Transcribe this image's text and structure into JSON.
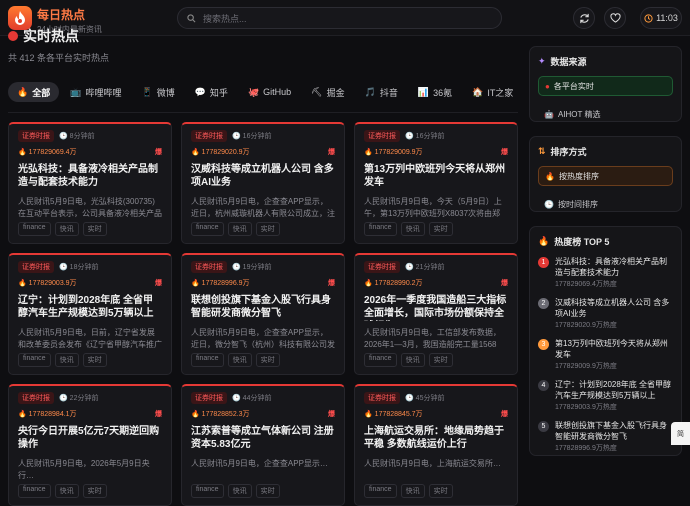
{
  "header": {
    "app_title": "每日热点",
    "app_subtitle": "24小时内最新资讯",
    "search_placeholder": "搜索热点...",
    "clock": "11:03"
  },
  "main": {
    "heading": "实时热点",
    "subtitle": "共 412 条各平台实时热点",
    "tabs": [
      {
        "icon": "🔥",
        "label": "全部",
        "active": true
      },
      {
        "icon": "📺",
        "label": "哔哩哔哩"
      },
      {
        "icon": "📱",
        "label": "微博"
      },
      {
        "icon": "💬",
        "label": "知乎"
      },
      {
        "icon": "🐙",
        "label": "GitHub"
      },
      {
        "icon": "⛏",
        "label": "掘金"
      },
      {
        "icon": "🎵",
        "label": "抖音"
      },
      {
        "icon": "📊",
        "label": "36氪"
      },
      {
        "icon": "🏠",
        "label": "IT之家"
      }
    ],
    "cards": [
      {
        "badge": "证券时报",
        "time": "8分钟前",
        "hot": "177829069.4万",
        "hot_tag": "爆",
        "title": "光弘科技：具备液冷相关产品制造与配套技术能力",
        "desc": "人民财讯5月9日电，光弘科技(300735)在互动平台表示，公司具备液冷相关产品成…",
        "tags": [
          "finance",
          "快讯",
          "实时"
        ]
      },
      {
        "badge": "证券时报",
        "time": "16分钟前",
        "hot": "177829020.9万",
        "hot_tag": "爆",
        "title": "汉威科技等成立机器人公司 含多项AI业务",
        "desc": "人民财讯5月9日电，企查查APP显示，近日，杭州威璇机器人有限公司成立，注册…",
        "tags": [
          "finance",
          "快讯",
          "实时"
        ]
      },
      {
        "badge": "证券时报",
        "time": "16分钟前",
        "hot": "177829009.9万",
        "hot_tag": "爆",
        "title": "第13万列中欧班列今天将从郑州发车",
        "desc": "人民财讯5月9日电，今天（5月9日）上午，第13万列中欧班列X8037次将由郑州…",
        "tags": [
          "finance",
          "快讯",
          "实时"
        ]
      },
      {
        "badge": "证券时报",
        "time": "18分钟前",
        "hot": "177829003.9万",
        "hot_tag": "爆",
        "title": "辽宁：计划到2028年底 全省甲醇汽车生产规模达到5万辆以上",
        "desc": "人民财讯5月9日电，日前，辽宁省发展和改革委员会发布《辽宁省甲醇汽车推广应…",
        "tags": [
          "finance",
          "快讯",
          "实时"
        ]
      },
      {
        "badge": "证券时报",
        "time": "19分钟前",
        "hot": "177828996.9万",
        "hot_tag": "爆",
        "title": "联想创投旗下基金入股飞行具身智能研发商微分智飞",
        "desc": "人民财讯5月9日电，企查查APP显示，近日，微分智飞（杭州）科技有限公司发生…",
        "tags": [
          "finance",
          "快讯",
          "实时"
        ]
      },
      {
        "badge": "证券时报",
        "time": "21分钟前",
        "hot": "177828990.2万",
        "hot_tag": "爆",
        "title": "2026年一季度我国造船三大指标全面增长，国际市场份额保持全球领先",
        "desc": "人民财讯5月9日电，工信部发布数据，2026年1—3月，我国造船完工量1568万…",
        "tags": [
          "finance",
          "快讯",
          "实时"
        ]
      },
      {
        "badge": "证券时报",
        "time": "22分钟前",
        "hot": "177828984.1万",
        "hot_tag": "爆",
        "title": "央行今日开展5亿元7天期逆回购操作",
        "desc": "人民财讯5月9日电，2026年5月9日央行…",
        "tags": [
          "finance",
          "快讯",
          "实时"
        ]
      },
      {
        "badge": "证券时报",
        "time": "44分钟前",
        "hot": "177828852.3万",
        "hot_tag": "爆",
        "title": "江苏索普等成立气体新公司 注册资本5.83亿元",
        "desc": "人民财讯5月9日电，企查查APP显示…",
        "tags": [
          "finance",
          "快讯",
          "实时"
        ]
      },
      {
        "badge": "证券时报",
        "time": "45分钟前",
        "hot": "177828845.7万",
        "hot_tag": "爆",
        "title": "上海航运交易所：地缘局势趋于平稳 多数航线运价上行",
        "desc": "人民财讯5月9日电，上海航运交易所…",
        "tags": [
          "finance",
          "快讯",
          "实时"
        ]
      }
    ]
  },
  "right": {
    "source": {
      "title": "数据来源",
      "options": [
        "各平台实时",
        "AIHOT 精选"
      ]
    },
    "sort": {
      "title": "排序方式",
      "options": [
        "按热度排序",
        "按时间排序"
      ]
    },
    "top": {
      "title": "热度榜 TOP 5",
      "items": [
        {
          "rank": "1",
          "title": "光弘科技：具备液冷相关产品制造与配套技术能力",
          "heat": "177829069.4万热度"
        },
        {
          "rank": "2",
          "title": "汉威科技等成立机器人公司 含多项AI业务",
          "heat": "177829020.9万热度"
        },
        {
          "rank": "3",
          "title": "第13万列中欧班列今天将从郑州发车",
          "heat": "177829009.9万热度"
        },
        {
          "rank": "4",
          "title": "辽宁：计划到2028年底 全省甲醇汽车生产规模达到5万辆以上",
          "heat": "177829003.9万热度"
        },
        {
          "rank": "5",
          "title": "联想创投旗下基金入股飞行具身智能研发商微分智飞",
          "heat": "177828996.9万热度"
        }
      ]
    },
    "corner_label": "简"
  },
  "colors": {
    "accent": "#ff7a45",
    "hot": "#e53935",
    "green": "#1f5a33"
  }
}
